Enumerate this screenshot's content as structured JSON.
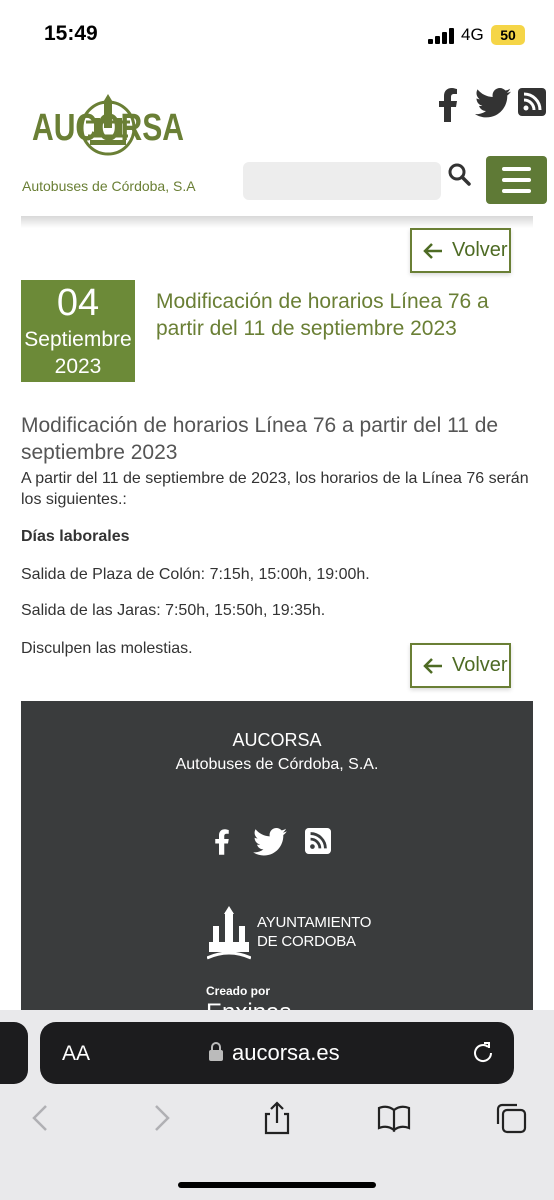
{
  "status_bar": {
    "time": "15:49",
    "network": "4G",
    "battery": "50"
  },
  "header": {
    "logo_text": "AUCORSA",
    "logo_caption": "Autobuses de Córdoba, S.A",
    "search_placeholder": "",
    "social_icons": [
      "facebook-icon",
      "twitter-icon",
      "rss-icon"
    ]
  },
  "back_label": "Volver",
  "news": {
    "day": "04",
    "month": "Septiembre",
    "year": "2023",
    "title": "Modificación de horarios Línea 76 a partir del 11 de septiembre 2023"
  },
  "article": {
    "title": "Modificación de horarios Línea 76 a partir del 11 de septiembre 2023",
    "intro": "A partir del 11 de septiembre de 2023, los horarios de la Línea 76 serán los siguientes.:",
    "subhead": "Días laborales",
    "line1": "Salida de Plaza de Colón: 7:15h, 15:00h, 19:00h.",
    "line2": "Salida de las Jaras: 7:50h, 15:50h, 19:35h.",
    "line3": "Disculpen las molestias."
  },
  "footer": {
    "name": "AUCORSA",
    "subtitle": "Autobuses de Córdoba, S.A.",
    "ayto_line1": "AYUNTAMIENTO",
    "ayto_line2": "DE CORDOBA",
    "created_by": "Creado por",
    "creator": "Enxinas"
  },
  "browser": {
    "aa_label": "AA",
    "url": "aucorsa.es"
  },
  "colors": {
    "brand_green": "#6c8a38",
    "text_green": "#6a7f35",
    "footer_bg": "#3a3c3d",
    "battery_yellow": "#f5d547"
  }
}
